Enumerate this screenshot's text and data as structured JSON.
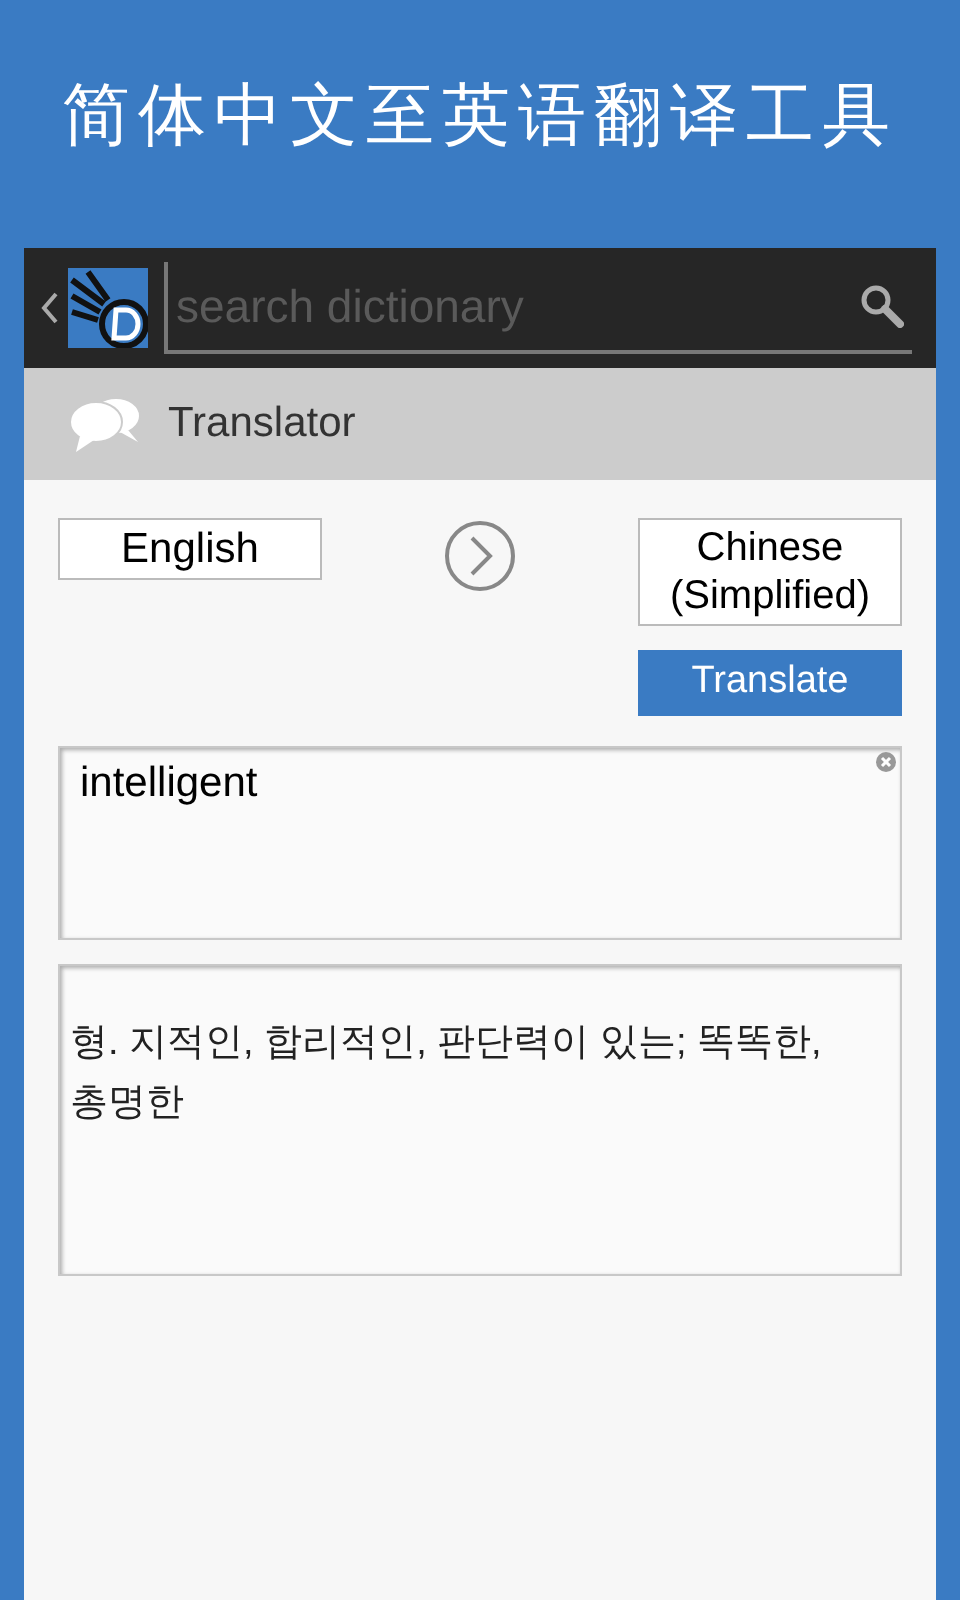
{
  "banner": {
    "title": "简体中文至英语翻译工具"
  },
  "toolbar": {
    "search": {
      "placeholder": "search dictionary"
    }
  },
  "header": {
    "title": "Translator"
  },
  "languages": {
    "source": "English",
    "target": "Chinese (Simplified)"
  },
  "translate_button": "Translate",
  "input": {
    "value": "intelligent"
  },
  "output": {
    "text": "형. 지적인, 합리적인, 판단력이 있는; 똑똑한, 총명한"
  }
}
